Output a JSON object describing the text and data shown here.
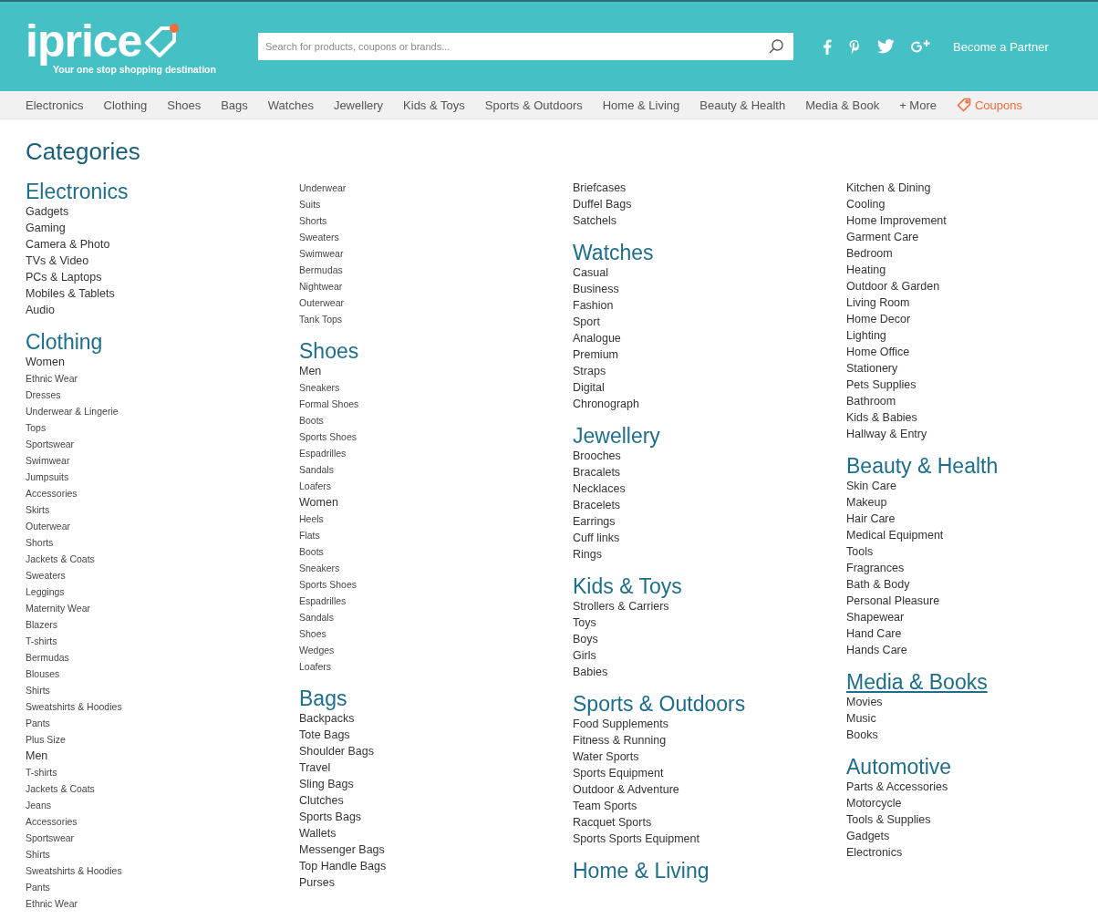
{
  "header": {
    "logo": "iprice",
    "tagline": "Your one stop shopping destination",
    "search": {
      "placeholder": "Search for products, coupons or brands..."
    },
    "partner_link": "Become a Partner"
  },
  "nav": [
    {
      "label": "Electronics",
      "kind": "link"
    },
    {
      "label": "Clothing",
      "kind": "link"
    },
    {
      "label": "Shoes",
      "kind": "link"
    },
    {
      "label": "Bags",
      "kind": "link"
    },
    {
      "label": "Watches",
      "kind": "link"
    },
    {
      "label": "Jewellery",
      "kind": "link"
    },
    {
      "label": "Kids & Toys",
      "kind": "link"
    },
    {
      "label": "Sports & Outdoors",
      "kind": "link"
    },
    {
      "label": "Home & Living",
      "kind": "link"
    },
    {
      "label": "Beauty & Health",
      "kind": "link"
    },
    {
      "label": "Media & Book",
      "kind": "link"
    },
    {
      "label": "+ More",
      "kind": "link"
    },
    {
      "label": "Coupons",
      "kind": "coupon"
    }
  ],
  "title": "Categories",
  "columns": [
    [
      {
        "kind": "heading",
        "text": "Electronics",
        "hovered": false
      },
      {
        "kind": "link",
        "text": "Gadgets"
      },
      {
        "kind": "link",
        "text": "Gaming"
      },
      {
        "kind": "link",
        "text": "Camera & Photo"
      },
      {
        "kind": "link",
        "text": "TVs & Video"
      },
      {
        "kind": "link",
        "text": "PCs & Laptops"
      },
      {
        "kind": "link",
        "text": "Mobiles & Tablets"
      },
      {
        "kind": "link",
        "text": "Audio"
      },
      {
        "kind": "heading",
        "text": "Clothing",
        "hovered": false
      },
      {
        "kind": "link",
        "text": "Women"
      },
      {
        "kind": "sublink",
        "text": "Ethnic Wear"
      },
      {
        "kind": "sublink",
        "text": "Dresses"
      },
      {
        "kind": "sublink",
        "text": "Underwear & Lingerie"
      },
      {
        "kind": "sublink",
        "text": "Tops"
      },
      {
        "kind": "sublink",
        "text": "Sportswear"
      },
      {
        "kind": "sublink",
        "text": "Swimwear"
      },
      {
        "kind": "sublink",
        "text": "Jumpsuits"
      },
      {
        "kind": "sublink",
        "text": "Accessories"
      },
      {
        "kind": "sublink",
        "text": "Skirts"
      },
      {
        "kind": "sublink",
        "text": "Outerwear"
      },
      {
        "kind": "sublink",
        "text": "Shorts"
      },
      {
        "kind": "sublink",
        "text": "Jackets & Coats"
      },
      {
        "kind": "sublink",
        "text": "Sweaters"
      },
      {
        "kind": "sublink",
        "text": "Leggings"
      },
      {
        "kind": "sublink",
        "text": "Maternity Wear"
      },
      {
        "kind": "sublink",
        "text": "Blazers"
      },
      {
        "kind": "sublink",
        "text": "T-shirts"
      },
      {
        "kind": "sublink",
        "text": "Bermudas"
      },
      {
        "kind": "sublink",
        "text": "Blouses"
      },
      {
        "kind": "sublink",
        "text": "Shirts"
      },
      {
        "kind": "sublink",
        "text": "Sweatshirts & Hoodies"
      },
      {
        "kind": "sublink",
        "text": "Pants"
      },
      {
        "kind": "sublink",
        "text": "Plus Size"
      },
      {
        "kind": "link",
        "text": "Men"
      },
      {
        "kind": "sublink",
        "text": "T-shirts"
      },
      {
        "kind": "sublink",
        "text": "Jackets & Coats"
      },
      {
        "kind": "sublink",
        "text": "Jeans"
      },
      {
        "kind": "sublink",
        "text": "Accessories"
      },
      {
        "kind": "sublink",
        "text": "Sportswear"
      },
      {
        "kind": "sublink",
        "text": "Shirts"
      },
      {
        "kind": "sublink",
        "text": "Sweatshirts & Hoodies"
      },
      {
        "kind": "sublink",
        "text": "Pants"
      },
      {
        "kind": "sublink",
        "text": "Ethnic Wear"
      }
    ],
    [
      {
        "kind": "sublink",
        "text": "Underwear"
      },
      {
        "kind": "sublink",
        "text": "Suits"
      },
      {
        "kind": "sublink",
        "text": "Shorts"
      },
      {
        "kind": "sublink",
        "text": "Sweaters"
      },
      {
        "kind": "sublink",
        "text": "Swimwear"
      },
      {
        "kind": "sublink",
        "text": "Bermudas"
      },
      {
        "kind": "sublink",
        "text": "Nightwear"
      },
      {
        "kind": "sublink",
        "text": "Outerwear"
      },
      {
        "kind": "sublink",
        "text": "Tank Tops"
      },
      {
        "kind": "heading",
        "text": "Shoes",
        "hovered": false
      },
      {
        "kind": "link",
        "text": "Men"
      },
      {
        "kind": "sublink",
        "text": "Sneakers"
      },
      {
        "kind": "sublink",
        "text": "Formal Shoes"
      },
      {
        "kind": "sublink",
        "text": "Boots"
      },
      {
        "kind": "sublink",
        "text": "Sports Shoes"
      },
      {
        "kind": "sublink",
        "text": "Espadrilles"
      },
      {
        "kind": "sublink",
        "text": "Sandals"
      },
      {
        "kind": "sublink",
        "text": "Loafers"
      },
      {
        "kind": "link",
        "text": "Women"
      },
      {
        "kind": "sublink",
        "text": "Heels"
      },
      {
        "kind": "sublink",
        "text": "Flats"
      },
      {
        "kind": "sublink",
        "text": "Boots"
      },
      {
        "kind": "sublink",
        "text": "Sneakers"
      },
      {
        "kind": "sublink",
        "text": "Sports Shoes"
      },
      {
        "kind": "sublink",
        "text": "Espadrilles"
      },
      {
        "kind": "sublink",
        "text": "Sandals"
      },
      {
        "kind": "sublink",
        "text": "Shoes"
      },
      {
        "kind": "sublink",
        "text": "Wedges"
      },
      {
        "kind": "sublink",
        "text": "Loafers"
      },
      {
        "kind": "heading",
        "text": "Bags",
        "hovered": false
      },
      {
        "kind": "link",
        "text": "Backpacks"
      },
      {
        "kind": "link",
        "text": "Tote Bags"
      },
      {
        "kind": "link",
        "text": "Shoulder Bags"
      },
      {
        "kind": "link",
        "text": "Travel"
      },
      {
        "kind": "link",
        "text": "Sling Bags"
      },
      {
        "kind": "link",
        "text": "Clutches"
      },
      {
        "kind": "link",
        "text": "Sports Bags"
      },
      {
        "kind": "link",
        "text": "Wallets"
      },
      {
        "kind": "link",
        "text": "Messenger Bags"
      },
      {
        "kind": "link",
        "text": "Top Handle Bags"
      },
      {
        "kind": "link",
        "text": "Purses"
      }
    ],
    [
      {
        "kind": "link",
        "text": "Briefcases"
      },
      {
        "kind": "link",
        "text": "Duffel Bags"
      },
      {
        "kind": "link",
        "text": "Satchels"
      },
      {
        "kind": "heading",
        "text": "Watches",
        "hovered": false
      },
      {
        "kind": "link",
        "text": "Casual"
      },
      {
        "kind": "link",
        "text": "Business"
      },
      {
        "kind": "link",
        "text": "Fashion"
      },
      {
        "kind": "link",
        "text": "Sport"
      },
      {
        "kind": "link",
        "text": "Analogue"
      },
      {
        "kind": "link",
        "text": "Premium"
      },
      {
        "kind": "link",
        "text": "Straps"
      },
      {
        "kind": "link",
        "text": "Digital"
      },
      {
        "kind": "link",
        "text": "Chronograph"
      },
      {
        "kind": "heading",
        "text": "Jewellery",
        "hovered": false
      },
      {
        "kind": "link",
        "text": "Brooches"
      },
      {
        "kind": "link",
        "text": "Bracalets"
      },
      {
        "kind": "link",
        "text": "Necklaces"
      },
      {
        "kind": "link",
        "text": "Bracelets"
      },
      {
        "kind": "link",
        "text": "Earrings"
      },
      {
        "kind": "link",
        "text": "Cuff links"
      },
      {
        "kind": "link",
        "text": "Rings"
      },
      {
        "kind": "heading",
        "text": "Kids & Toys",
        "hovered": false
      },
      {
        "kind": "link",
        "text": "Strollers & Carriers"
      },
      {
        "kind": "link",
        "text": "Toys"
      },
      {
        "kind": "link",
        "text": "Boys"
      },
      {
        "kind": "link",
        "text": "Girls"
      },
      {
        "kind": "link",
        "text": "Babies"
      },
      {
        "kind": "heading",
        "text": "Sports & Outdoors",
        "hovered": false
      },
      {
        "kind": "link",
        "text": "Food Supplements"
      },
      {
        "kind": "link",
        "text": "Fitness & Running"
      },
      {
        "kind": "link",
        "text": "Water Sports"
      },
      {
        "kind": "link",
        "text": "Sports Equipment"
      },
      {
        "kind": "link",
        "text": "Outdoor & Adventure"
      },
      {
        "kind": "link",
        "text": "Team Sports"
      },
      {
        "kind": "link",
        "text": "Racquet Sports"
      },
      {
        "kind": "link",
        "text": "Sports Sports Equipment"
      },
      {
        "kind": "heading",
        "text": "Home & Living",
        "hovered": false
      }
    ],
    [
      {
        "kind": "link",
        "text": "Kitchen & Dining"
      },
      {
        "kind": "link",
        "text": "Cooling"
      },
      {
        "kind": "link",
        "text": "Home Improvement"
      },
      {
        "kind": "link",
        "text": "Garment Care"
      },
      {
        "kind": "link",
        "text": "Bedroom"
      },
      {
        "kind": "link",
        "text": "Heating"
      },
      {
        "kind": "link",
        "text": "Outdoor & Garden"
      },
      {
        "kind": "link",
        "text": "Living Room"
      },
      {
        "kind": "link",
        "text": "Home Decor"
      },
      {
        "kind": "link",
        "text": "Lighting"
      },
      {
        "kind": "link",
        "text": "Home Office"
      },
      {
        "kind": "link",
        "text": "Stationery"
      },
      {
        "kind": "link",
        "text": "Pets Supplies"
      },
      {
        "kind": "link",
        "text": "Bathroom"
      },
      {
        "kind": "link",
        "text": "Kids & Babies"
      },
      {
        "kind": "link",
        "text": "Hallway & Entry"
      },
      {
        "kind": "heading",
        "text": "Beauty & Health",
        "hovered": false
      },
      {
        "kind": "link",
        "text": "Skin Care"
      },
      {
        "kind": "link",
        "text": "Makeup"
      },
      {
        "kind": "link",
        "text": "Hair Care"
      },
      {
        "kind": "link",
        "text": "Medical Equipment"
      },
      {
        "kind": "link",
        "text": "Tools"
      },
      {
        "kind": "link",
        "text": "Fragrances"
      },
      {
        "kind": "link",
        "text": "Bath & Body"
      },
      {
        "kind": "link",
        "text": "Personal Pleasure"
      },
      {
        "kind": "link",
        "text": "Shapewear"
      },
      {
        "kind": "link",
        "text": "Hand Care"
      },
      {
        "kind": "link",
        "text": "Hands Care"
      },
      {
        "kind": "heading",
        "text": "Media & Books",
        "hovered": true
      },
      {
        "kind": "link",
        "text": "Movies"
      },
      {
        "kind": "link",
        "text": "Music"
      },
      {
        "kind": "link",
        "text": "Books"
      },
      {
        "kind": "heading",
        "text": "Automotive",
        "hovered": false
      },
      {
        "kind": "link",
        "text": "Parts & Accessories"
      },
      {
        "kind": "link",
        "text": "Motorcycle"
      },
      {
        "kind": "link",
        "text": "Tools & Supplies"
      },
      {
        "kind": "link",
        "text": "Gadgets"
      },
      {
        "kind": "link",
        "text": "Electronics"
      }
    ]
  ]
}
